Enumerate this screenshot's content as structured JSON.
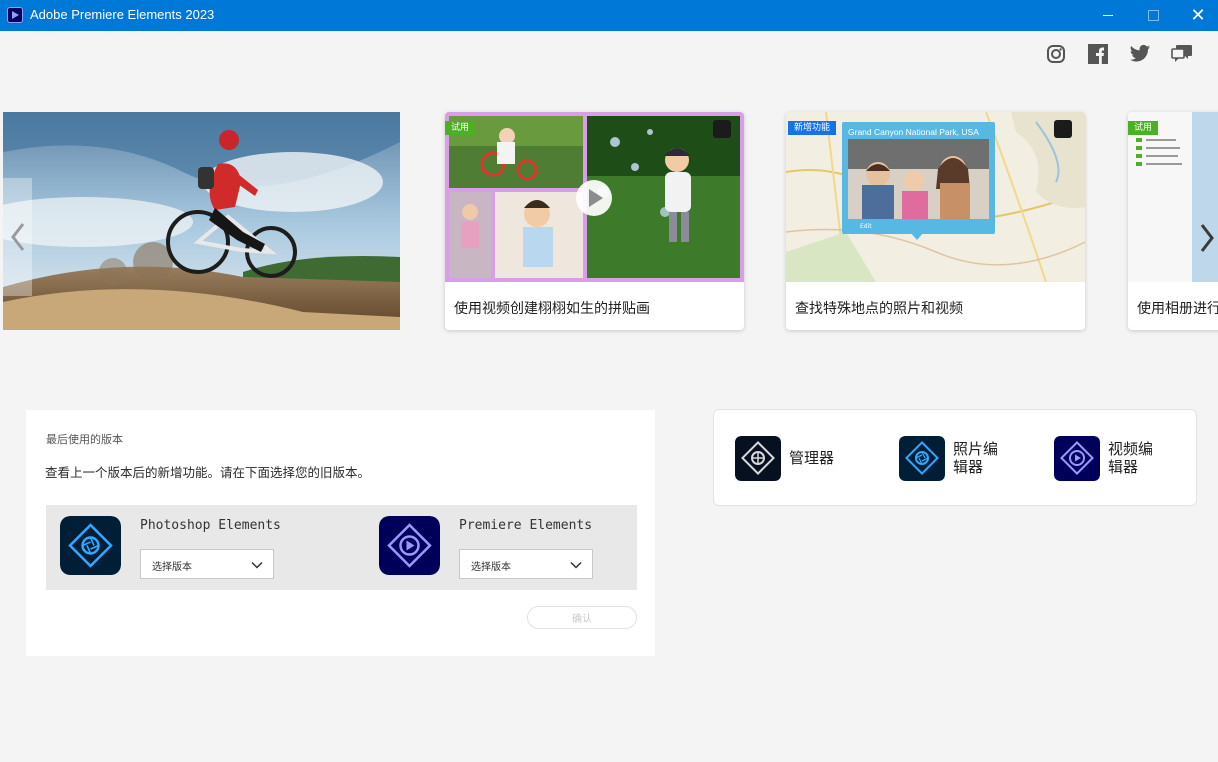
{
  "window": {
    "title": "Adobe Premiere Elements 2023",
    "minimize_glyph": "",
    "maximize_glyph": "",
    "close_glyph": "✕"
  },
  "social": {
    "icons": [
      "instagram-icon",
      "facebook-icon",
      "twitter-icon",
      "community-icon"
    ]
  },
  "carousel": {
    "cards": [
      {
        "tag": "试用",
        "caption": "使用视频创建栩栩如生的拼贴画"
      },
      {
        "tag": "新增功能",
        "map_title": "Grand Canyon National Park, USA",
        "map_edit": "Edit",
        "caption": "查找特殊地点的照片和视频"
      },
      {
        "tag": "试用",
        "caption": "使用相册进行"
      }
    ]
  },
  "previous_versions": {
    "heading": "最后使用的版本",
    "description": "查看上一个版本后的新增功能。请在下面选择您的旧版本。",
    "products": [
      {
        "name": "Photoshop Elements",
        "select_label": "选择版本"
      },
      {
        "name": "Premiere Elements",
        "select_label": "选择版本"
      }
    ],
    "confirm_label": "确认"
  },
  "launcher": {
    "items": [
      {
        "line1": "管理器",
        "line2": ""
      },
      {
        "line1": "照片编",
        "line2": "辑器"
      },
      {
        "line1": "视频编",
        "line2": "辑器"
      }
    ]
  },
  "colors": {
    "titlebar": "#0078d7",
    "photoshop_icon": "#001e36",
    "premiere_icon": "#00005b",
    "tag_green": "#4caf25",
    "tag_blue": "#1473e6"
  }
}
